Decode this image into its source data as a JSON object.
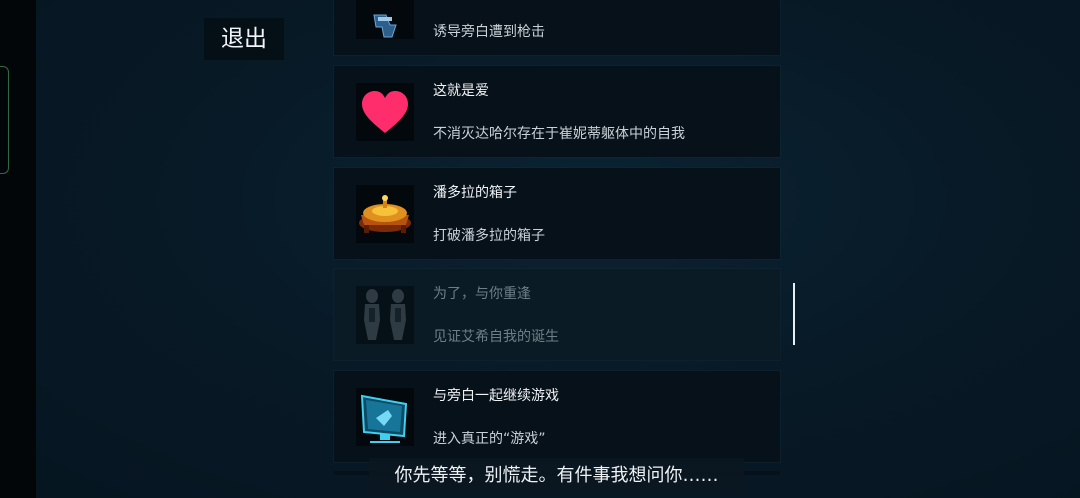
{
  "header": {
    "exit_label": "退出"
  },
  "achievements": [
    {
      "title": "",
      "description": "诱导旁白遭到枪击",
      "icon": "gun-icon",
      "locked": false
    },
    {
      "title": "这就是爱",
      "description": "不消灭达哈尔存在于崔妮蒂躯体中的自我",
      "icon": "heart-icon",
      "locked": false
    },
    {
      "title": "潘多拉的箱子",
      "description": "打破潘多拉的箱子",
      "icon": "pandora-box-icon",
      "locked": false
    },
    {
      "title": "为了，与你重逢",
      "description": "见证艾希自我的诞生",
      "icon": "twin-figures-icon",
      "locked": true
    },
    {
      "title": "与旁白一起继续游戏",
      "description": "进入真正的“游戏”",
      "icon": "monitor-icon",
      "locked": false
    }
  ],
  "subtitle": {
    "text": "你先等等，别慌走。有件事我想问你……"
  },
  "colors": {
    "background": "#081a27",
    "card": "#061119",
    "heart": "#ff2d6b",
    "monitor": "#3fd0f0",
    "box_gold": "#e0901e"
  }
}
